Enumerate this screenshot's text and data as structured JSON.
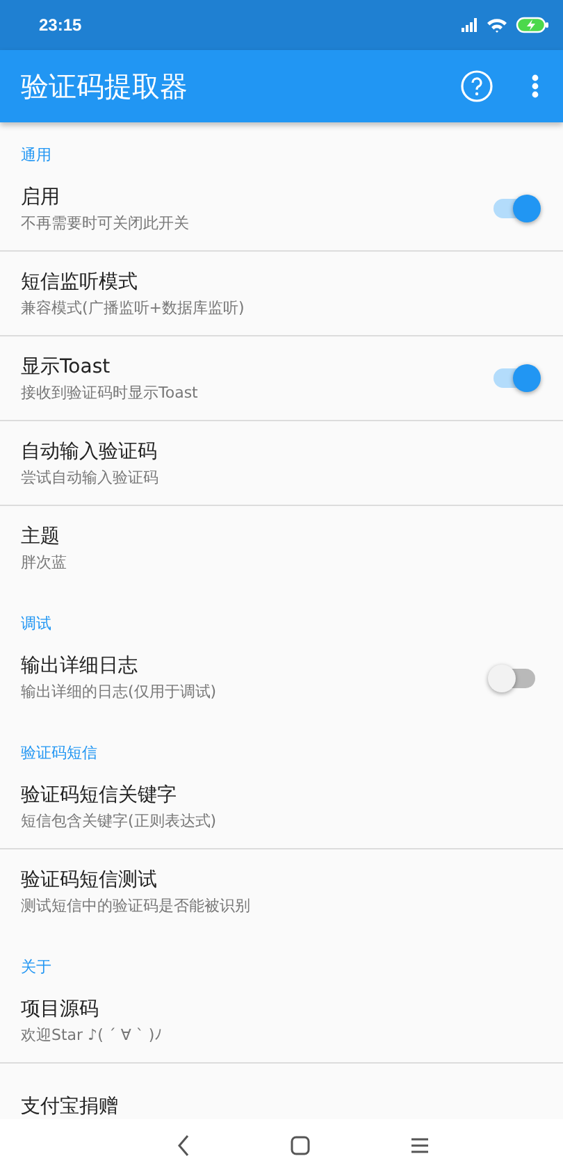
{
  "status_bar": {
    "time": "23:15"
  },
  "app_bar": {
    "title": "验证码提取器"
  },
  "sections": [
    {
      "header": "通用",
      "items": [
        {
          "kind": "switch",
          "title": "启用",
          "summary": "不再需要时可关闭此开关",
          "on": true
        },
        {
          "kind": "plain",
          "title": "短信监听模式",
          "summary": "兼容模式(广播监听+数据库监听)"
        },
        {
          "kind": "switch",
          "title": "显示Toast",
          "summary": "接收到验证码时显示Toast",
          "on": true
        },
        {
          "kind": "plain",
          "title": "自动输入验证码",
          "summary": "尝试自动输入验证码"
        },
        {
          "kind": "plain",
          "title": "主题",
          "summary": "胖次蓝"
        }
      ]
    },
    {
      "header": "调试",
      "items": [
        {
          "kind": "switch",
          "title": "输出详细日志",
          "summary": "输出详细的日志(仅用于调试)",
          "on": false
        }
      ]
    },
    {
      "header": "验证码短信",
      "items": [
        {
          "kind": "plain",
          "title": "验证码短信关键字",
          "summary": "短信包含关键字(正则表达式)"
        },
        {
          "kind": "plain",
          "title": "验证码短信测试",
          "summary": "测试短信中的验证码是否能被识别"
        }
      ]
    },
    {
      "header": "关于",
      "items": [
        {
          "kind": "plain",
          "title": "项目源码",
          "summary": "欢迎Star ♪( ´ ∀ ` )ﾉ"
        },
        {
          "kind": "plain",
          "title": "支付宝捐赠"
        }
      ]
    }
  ]
}
